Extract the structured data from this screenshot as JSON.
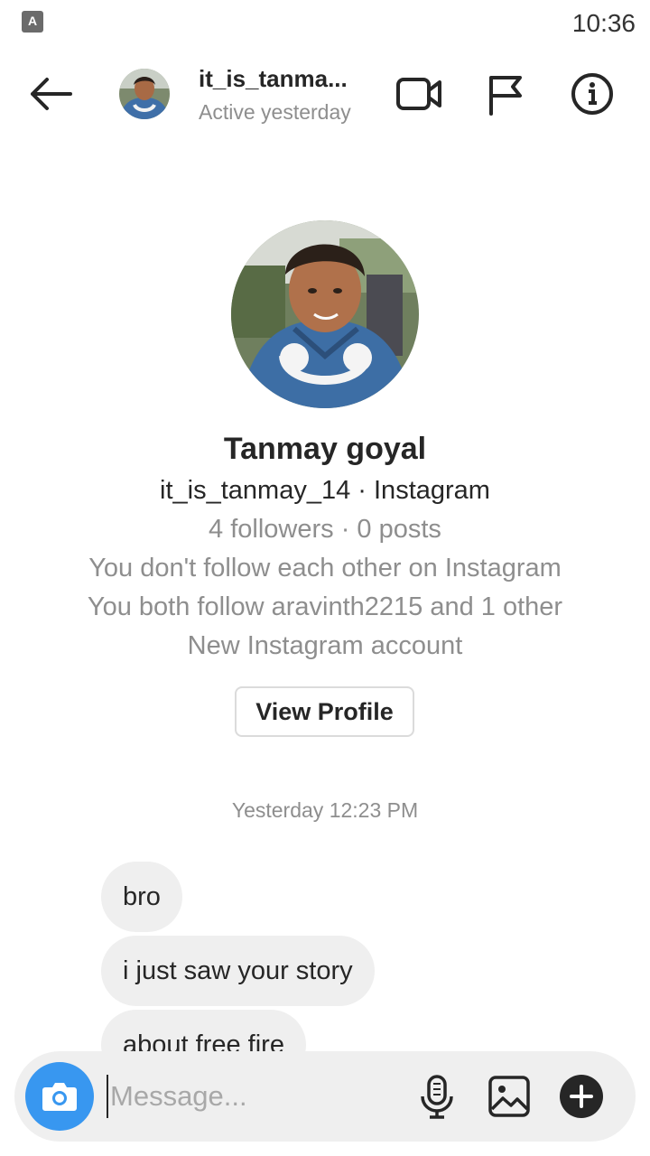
{
  "status_bar": {
    "app_icon_letter": "A",
    "time": "10:36"
  },
  "header": {
    "username": "it_is_tanma...",
    "status": "Active yesterday",
    "icons": [
      "back-arrow-icon",
      "video-camera-icon",
      "flag-icon",
      "info-icon"
    ]
  },
  "profile": {
    "name": "Tanmay goyal",
    "handle_line": "it_is_tanmay_14 · Instagram",
    "stats": "4 followers · 0 posts",
    "follow_status": "You don't follow each other on Instagram",
    "mutual": "You both follow aravinth2215 and 1 other",
    "account_note": "New Instagram account",
    "view_profile_label": "View Profile"
  },
  "conversation": {
    "timestamp": "Yesterday 12:23 PM",
    "messages": [
      {
        "text": "bro"
      },
      {
        "text": "i just saw your story"
      },
      {
        "text": "about free fire"
      }
    ]
  },
  "composer": {
    "placeholder": "Message...",
    "icons": [
      "camera-icon",
      "microphone-icon",
      "gallery-icon",
      "plus-icon"
    ]
  },
  "colors": {
    "accent": "#3897f0",
    "text_primary": "#262626",
    "text_secondary": "#8e8e8e",
    "bubble": "#efefef",
    "border": "#dbdbdb"
  }
}
